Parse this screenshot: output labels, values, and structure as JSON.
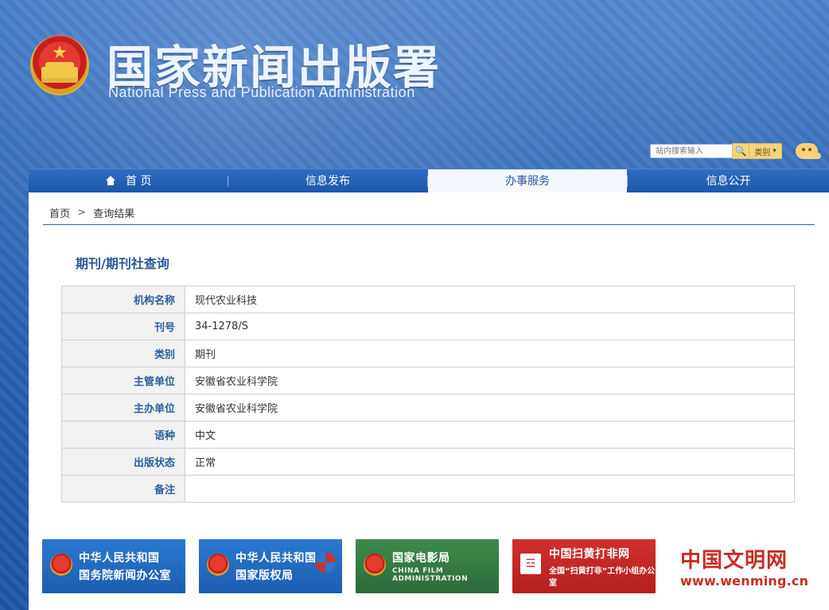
{
  "header": {
    "title_cn": "国家新闻出版署",
    "title_en": "National Press and Publication Administration",
    "search": {
      "placeholder": "站内搜索输入",
      "category_label": "类别"
    }
  },
  "nav": {
    "items": [
      {
        "label": "首 页"
      },
      {
        "label": "信息发布"
      },
      {
        "label": "办事服务"
      },
      {
        "label": "信息公开"
      }
    ],
    "active_index": 2
  },
  "breadcrumb": {
    "home": "首页",
    "separator": ">",
    "current": "查询结果"
  },
  "page": {
    "title": "期刊/期刊社查询"
  },
  "details": {
    "rows": [
      {
        "key": "机构名称",
        "value": "现代农业科技"
      },
      {
        "key": "刊号",
        "value": "34-1278/S"
      },
      {
        "key": "类别",
        "value": "期刊"
      },
      {
        "key": "主管单位",
        "value": "安徽省农业科学院"
      },
      {
        "key": "主办单位",
        "value": "安徽省农业科学院"
      },
      {
        "key": "语种",
        "value": "中文"
      },
      {
        "key": "出版状态",
        "value": "正常"
      },
      {
        "key": "备注",
        "value": ""
      }
    ]
  },
  "footer_links": [
    {
      "line1": "中华人民共和国",
      "line2": "国务院新闻办公室"
    },
    {
      "line1": "中华人民共和国",
      "line2": "国家版权局"
    },
    {
      "line1": "国家电影局",
      "line2": "CHINA FILM ADMINISTRATION"
    },
    {
      "line1": "中国扫黄打非网",
      "line2": "全国“扫黄打非”工作小组办公室"
    },
    {
      "line1": "中国文明网",
      "line2": "www.wenming.cn"
    }
  ]
}
